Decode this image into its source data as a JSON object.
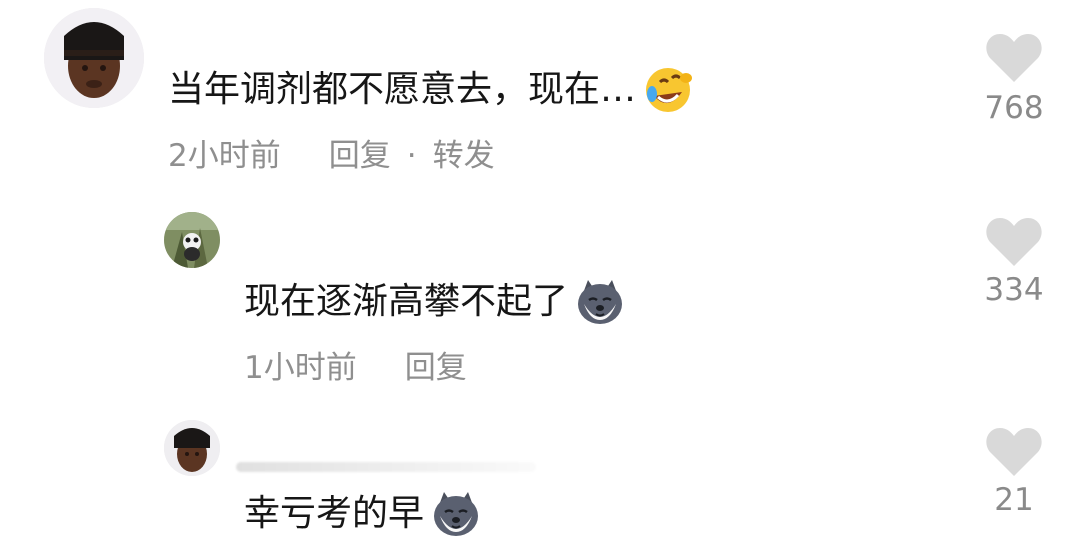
{
  "comments": [
    {
      "text": "当年调剂都不愿意去，现在…",
      "time": "2小时前",
      "reply_label": "回复",
      "dot": "·",
      "share_label": "转发",
      "likes": "768",
      "emoji": "rolling-on-floor-laughing-emoji"
    },
    {
      "text": "现在逐渐高攀不起了",
      "time": "1小时前",
      "reply_label": "回复",
      "likes": "334",
      "emoji": "dog-face-emoji"
    },
    {
      "text": "幸亏考的早",
      "likes": "21",
      "emoji": "dog-face-emoji"
    }
  ],
  "colors": {
    "text": "#161616",
    "meta": "#8f8f8f",
    "heart": "#d9d9d9",
    "background": "#ffffff"
  },
  "icons": {
    "like": "heart-icon"
  }
}
